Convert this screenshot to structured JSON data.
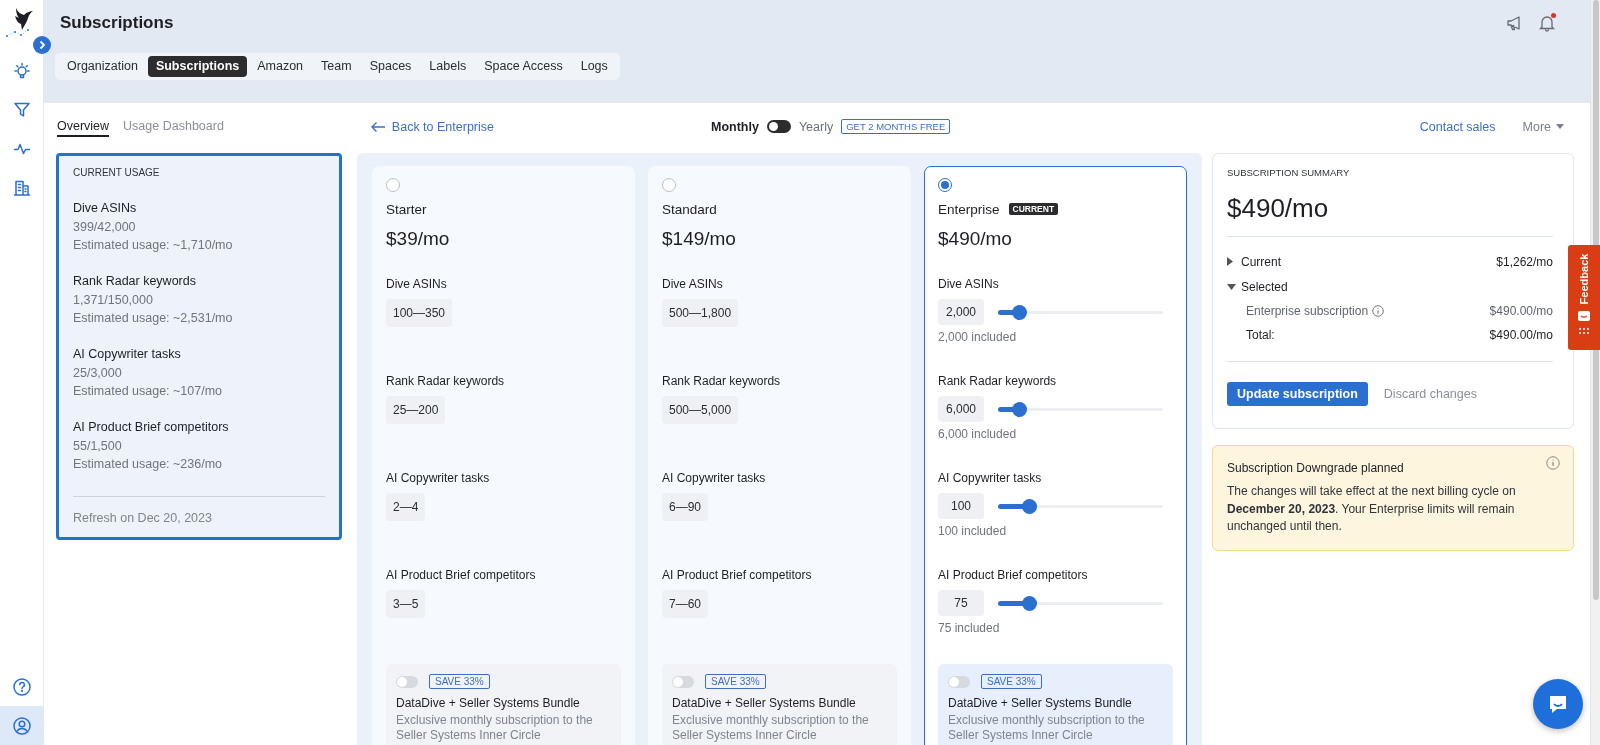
{
  "rail": {
    "items": [
      {
        "kind": "idea",
        "selected": false
      },
      {
        "kind": "filter",
        "selected": false
      },
      {
        "kind": "activity",
        "selected": false
      },
      {
        "kind": "building",
        "selected": false
      },
      {
        "kind": "help",
        "selected": false
      },
      {
        "kind": "account",
        "selected": true
      }
    ]
  },
  "header": {
    "title": "Subscriptions",
    "notifications": {
      "unread": true
    },
    "tabs": [
      {
        "label": "Organization",
        "selected": false
      },
      {
        "label": "Subscriptions",
        "selected": true
      },
      {
        "label": "Amazon",
        "selected": false
      },
      {
        "label": "Team",
        "selected": false
      },
      {
        "label": "Spaces",
        "selected": false
      },
      {
        "label": "Labels",
        "selected": false
      },
      {
        "label": "Space Access",
        "selected": false
      },
      {
        "label": "Logs",
        "selected": false
      }
    ]
  },
  "subnav": {
    "tabs": [
      {
        "label": "Overview",
        "selected": true
      },
      {
        "label": "Usage Dashboard",
        "selected": false
      }
    ],
    "back_link": "Back to Enterprise",
    "billing": {
      "monthly_label": "Monthly",
      "yearly_label": "Yearly",
      "yearly": false,
      "promo": "GET 2 MONTHS FREE"
    },
    "contact_link": "Contact sales",
    "more_menu": "More"
  },
  "usage": {
    "title": "CURRENT USAGE",
    "items": [
      {
        "name": "Dive ASINs",
        "value": "399/42,000",
        "estimate": "Estimated usage: ~1,710/mo"
      },
      {
        "name": "Rank Radar keywords",
        "value": "1,371/150,000",
        "estimate": "Estimated usage: ~2,531/mo"
      },
      {
        "name": "AI Copywriter tasks",
        "value": "25/3,000",
        "estimate": "Estimated usage: ~107/mo"
      },
      {
        "name": "AI Product Brief competitors",
        "value": "55/1,500",
        "estimate": "Estimated usage: ~236/mo"
      }
    ],
    "refresh": "Refresh on Dec 20, 2023"
  },
  "plans": [
    {
      "name": "Starter",
      "selected": false,
      "price": "$39/mo",
      "features": [
        {
          "kind": "range",
          "name": "Dive ASINs",
          "range": "100—350"
        },
        {
          "kind": "range",
          "name": "Rank Radar keywords",
          "range": "25—200"
        },
        {
          "kind": "range",
          "name": "AI Copywriter tasks",
          "range": "2—4"
        },
        {
          "kind": "range",
          "name": "AI Product Brief competitors",
          "range": "3—5"
        }
      ],
      "bundle": {
        "on": false,
        "badge": "SAVE 33%",
        "title": "DataDive + Seller Systems Bundle",
        "description": "Exclusive monthly subscription to the Seller Systems Inner Circle"
      }
    },
    {
      "name": "Standard",
      "selected": false,
      "price": "$149/mo",
      "features": [
        {
          "kind": "range",
          "name": "Dive ASINs",
          "range": "500—1,800"
        },
        {
          "kind": "range",
          "name": "Rank Radar keywords",
          "range": "500—5,000"
        },
        {
          "kind": "range",
          "name": "AI Copywriter tasks",
          "range": "6—90"
        },
        {
          "kind": "range",
          "name": "AI Product Brief competitors",
          "range": "7—60"
        }
      ],
      "bundle": {
        "on": false,
        "badge": "SAVE 33%",
        "title": "DataDive + Seller Systems Bundle",
        "description": "Exclusive monthly subscription to the Seller Systems Inner Circle"
      }
    },
    {
      "name": "Enterprise",
      "selected": true,
      "badge": "CURRENT",
      "price": "$490/mo",
      "features": [
        {
          "kind": "slider",
          "name": "Dive ASINs",
          "value": "2,000",
          "level": 0.13,
          "included": "2,000 included"
        },
        {
          "kind": "slider",
          "name": "Rank Radar keywords",
          "value": "6,000",
          "level": 0.13,
          "included": "6,000 included"
        },
        {
          "kind": "slider",
          "name": "AI Copywriter tasks",
          "value": "100",
          "level": 0.19,
          "included": "100 included"
        },
        {
          "kind": "slider",
          "name": "AI Product Brief competitors",
          "value": "75",
          "level": 0.19,
          "included": "75 included"
        }
      ],
      "bundle": {
        "on": false,
        "badge": "SAVE 33%",
        "title": "DataDive + Seller Systems Bundle",
        "description": "Exclusive monthly subscription to the Seller Systems Inner Circle"
      }
    }
  ],
  "summary": {
    "title": "SUBSCRIPTION SUMMARY",
    "price": "$490/mo",
    "rows": [
      {
        "label": "Current",
        "amount": "$1,262/mo",
        "expanded": false
      },
      {
        "label": "Selected",
        "expanded": true,
        "children": [
          {
            "kind": "line",
            "label": "Enterprise subscription",
            "amount": "$490.00/mo"
          },
          {
            "kind": "total",
            "label": "Total:",
            "amount": "$490.00/mo"
          }
        ]
      }
    ],
    "primary_button": "Update subscription",
    "secondary_button": "Discard changes"
  },
  "notice": {
    "title": "Subscription Downgrade planned",
    "message": "The changes will take effect at the next billing cycle on **December 20, 2023**. Your Enterprise limits will remain unchanged until then."
  },
  "feedback": {
    "label": "Feedback"
  }
}
